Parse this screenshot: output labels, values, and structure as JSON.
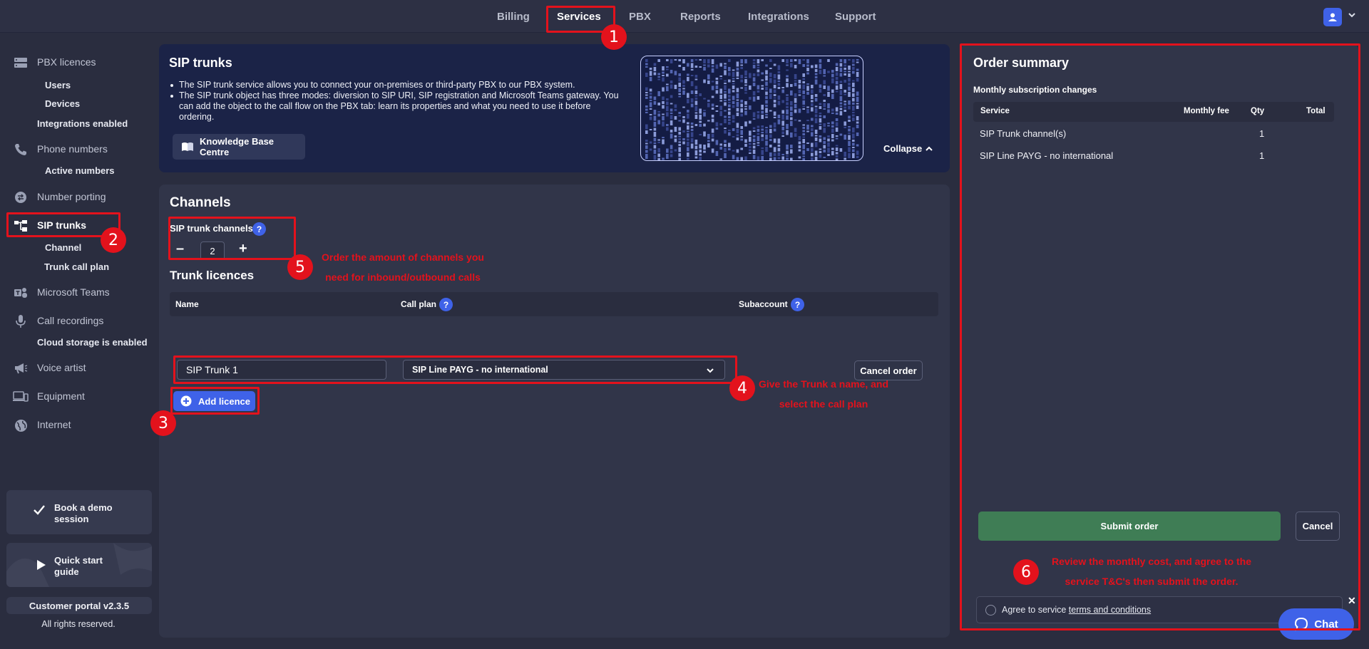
{
  "topnav": {
    "items": [
      {
        "label": "Billing",
        "active": false
      },
      {
        "label": "Services",
        "active": true
      },
      {
        "label": "PBX",
        "active": false
      },
      {
        "label": "Reports",
        "active": false
      },
      {
        "label": "Integrations",
        "active": false
      },
      {
        "label": "Support",
        "active": false
      }
    ]
  },
  "sidebar": {
    "pbx_licences": "PBX licences",
    "users": "Users",
    "devices": "Devices",
    "integrations_enabled": "Integrations enabled",
    "phone_numbers": "Phone numbers",
    "active_numbers": "Active numbers",
    "number_porting": "Number porting",
    "sip_trunks": "SIP trunks",
    "channel": "Channel",
    "trunk_call_plan": "Trunk call plan",
    "microsoft_teams": "Microsoft Teams",
    "call_recordings": "Call recordings",
    "cloud_storage": "Cloud storage is enabled",
    "voice_artist": "Voice artist",
    "equipment": "Equipment",
    "internet": "Internet",
    "book_demo": "Book a demo session",
    "book_demo_l1": "Book a demo",
    "book_demo_l2": "session",
    "quick_start_l1": "Quick start",
    "quick_start_l2": "guide",
    "version": "Customer portal v2.3.5",
    "rights": "All rights reserved."
  },
  "hero": {
    "title": "SIP trunks",
    "bullet1": "The SIP trunk service allows you to connect your on-premises or third-party PBX to our PBX system.",
    "bullet2": "The SIP trunk object has three modes: diversion to SIP URI, SIP registration and Microsoft Teams gateway. You can add the object to the call flow on the PBX tab: learn its properties and what you need to use it before ordering.",
    "kb_button": "Knowledge Base Centre",
    "collapse": "Collapse"
  },
  "channels": {
    "title": "Channels",
    "sip_trunk_channels_label": "SIP trunk channels",
    "channel_count": "2",
    "help": "?"
  },
  "licences": {
    "title": "Trunk licences",
    "col_name": "Name",
    "col_call_plan": "Call plan",
    "col_subaccount": "Subaccount",
    "row": {
      "name": "SIP Trunk 1",
      "call_plan": "SIP Line PAYG - no international"
    },
    "cancel_order": "Cancel order",
    "add_licence": "Add licence"
  },
  "order_summary": {
    "title": "Order summary",
    "subtitle": "Monthly subscription changes",
    "col_service": "Service",
    "col_monthly_fee": "Monthly fee",
    "col_qty": "Qty",
    "col_total": "Total",
    "rows": [
      {
        "service": "SIP Trunk channel(s)",
        "qty": "1"
      },
      {
        "service": "SIP Line PAYG - no international",
        "qty": "1"
      }
    ],
    "submit": "Submit order",
    "cancel": "Cancel",
    "agree_text": "Agree to service ",
    "terms_link": "terms and conditions"
  },
  "annotations": {
    "n1": "1",
    "n2": "2",
    "n3": "3",
    "n4": "4",
    "n5": "5",
    "n6": "6",
    "note5_l1": "Order the amount of channels you",
    "note5_l2": "need for inbound/outbound calls",
    "note4_l1": "Give the Trunk a name, and",
    "note4_l2": "select the call plan",
    "note6_l1": "Review the monthly cost, and agree to the",
    "note6_l2": "service T&C's then submit the order.",
    "color": "#e3121c"
  },
  "chat": {
    "label": "Chat",
    "close": "✕"
  },
  "colors": {
    "accent": "#3f62e8",
    "submit": "#3f7d55",
    "background": "#2a2d3f"
  }
}
